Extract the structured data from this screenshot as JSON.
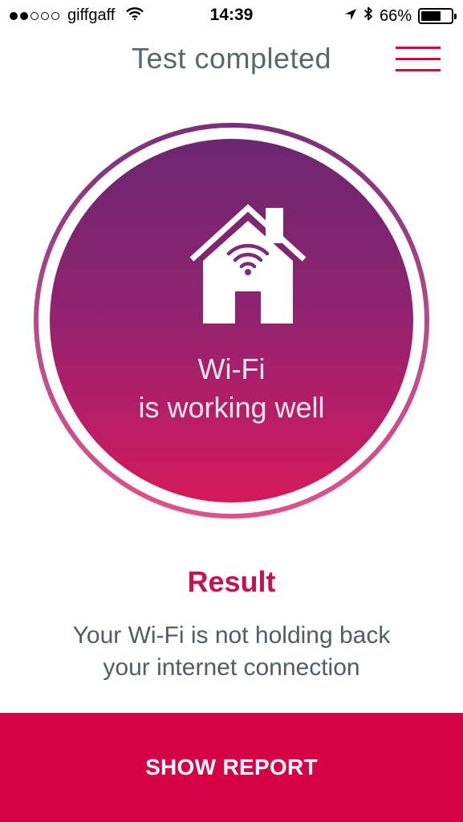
{
  "status_bar": {
    "carrier": "giffgaff",
    "time": "14:39",
    "battery_percent": "66%",
    "battery_level": 0.66,
    "signal_bars_filled": 2,
    "signal_bars_total": 5,
    "icons": [
      "signal-dots-icon",
      "wifi-icon",
      "location-arrow-icon",
      "bluetooth-icon",
      "battery-icon"
    ]
  },
  "header": {
    "title": "Test completed",
    "menu_icon": "hamburger-menu-icon"
  },
  "status_circle": {
    "icon": "house-wifi-icon",
    "line1": "Wi-Fi",
    "line2": "is working well"
  },
  "result": {
    "heading": "Result",
    "line1": "Your Wi-Fi is not holding back",
    "line2": "your internet connection"
  },
  "actions": {
    "show_report_label": "SHOW REPORT"
  },
  "colors": {
    "accent": "#d50045",
    "result_heading": "#c5134e",
    "title_text": "#5a6670",
    "body_text": "#4f5d66",
    "circle_gradient_top": "#6c2670",
    "circle_gradient_bottom": "#d41a58"
  }
}
